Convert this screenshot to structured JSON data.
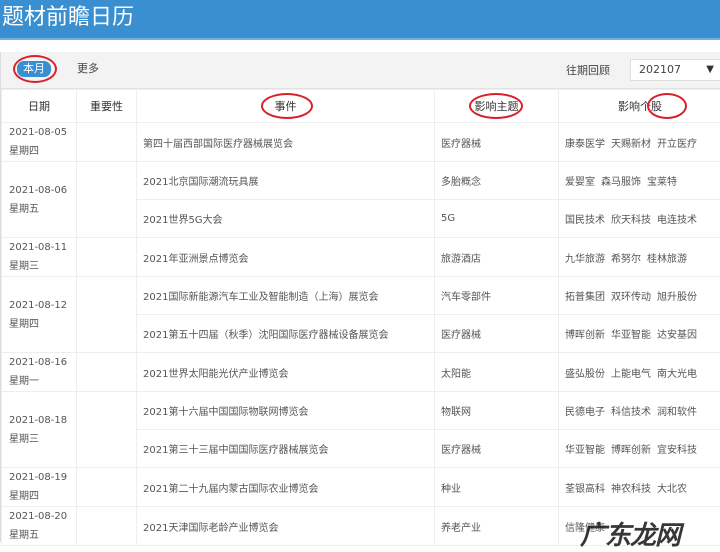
{
  "header": {
    "title": "题材前瞻日历"
  },
  "toolbar": {
    "tab_current": "本月",
    "tab_more": "更多",
    "history_label": "往期回顾",
    "history_value": "202107",
    "dropdown_icon": "triangle-down-icon"
  },
  "table": {
    "columns": [
      "日期",
      "重要性",
      "事件",
      "影响主题",
      "影响个股"
    ],
    "groups": [
      {
        "date": "2021-08-05",
        "weekday": "星期四",
        "events": [
          {
            "event": "第四十届西部国际医疗器械展览会",
            "theme": "医疗器械",
            "stocks": [
              "康泰医学",
              "天赐新材",
              "开立医疗"
            ]
          }
        ]
      },
      {
        "date": "2021-08-06",
        "weekday": "星期五",
        "events": [
          {
            "event": "2021北京国际潮流玩具展",
            "theme": "多胎概念",
            "stocks": [
              "爱婴室",
              "森马服饰",
              "宝莱特"
            ]
          },
          {
            "event": "2021世界5G大会",
            "theme": "5G",
            "stocks": [
              "国民技术",
              "欣天科技",
              "电连技术"
            ]
          }
        ]
      },
      {
        "date": "2021-08-11",
        "weekday": "星期三",
        "events": [
          {
            "event": "2021年亚洲景点博览会",
            "theme": "旅游酒店",
            "stocks": [
              "九华旅游",
              "希努尔",
              "桂林旅游"
            ]
          }
        ]
      },
      {
        "date": "2021-08-12",
        "weekday": "星期四",
        "events": [
          {
            "event": "2021国际新能源汽车工业及智能制造（上海）展览会",
            "theme": "汽车零部件",
            "stocks": [
              "拓普集团",
              "双环传动",
              "旭升股份"
            ]
          },
          {
            "event": "2021第五十四届（秋季）沈阳国际医疗器械设备展览会",
            "theme": "医疗器械",
            "stocks": [
              "博晖创新",
              "华亚智能",
              "达安基因"
            ]
          }
        ]
      },
      {
        "date": "2021-08-16",
        "weekday": "星期一",
        "events": [
          {
            "event": "2021世界太阳能光伏产业博览会",
            "theme": "太阳能",
            "stocks": [
              "盛弘股份",
              "上能电气",
              "南大光电"
            ]
          }
        ]
      },
      {
        "date": "2021-08-18",
        "weekday": "星期三",
        "events": [
          {
            "event": "2021第十六届中国国际物联网博览会",
            "theme": "物联网",
            "stocks": [
              "民德电子",
              "科信技术",
              "润和软件"
            ]
          },
          {
            "event": "2021第三十三届中国国际医疗器械展览会",
            "theme": "医疗器械",
            "stocks": [
              "华亚智能",
              "博晖创新",
              "宜安科技"
            ]
          }
        ]
      },
      {
        "date": "2021-08-19",
        "weekday": "星期四",
        "events": [
          {
            "event": "2021第二十九届内蒙古国际农业博览会",
            "theme": "种业",
            "stocks": [
              "荃银高科",
              "神农科技",
              "大北农"
            ]
          }
        ]
      },
      {
        "date": "2021-08-20",
        "weekday": "星期五",
        "events": [
          {
            "event": "2021天津国际老龄产业博览会",
            "theme": "养老产业",
            "stocks": [
              "信隆健康"
            ]
          }
        ]
      }
    ]
  },
  "watermark": "广东龙网",
  "colors": {
    "header_blue": "#3a8fd0",
    "annotation_red": "#d8202a"
  }
}
